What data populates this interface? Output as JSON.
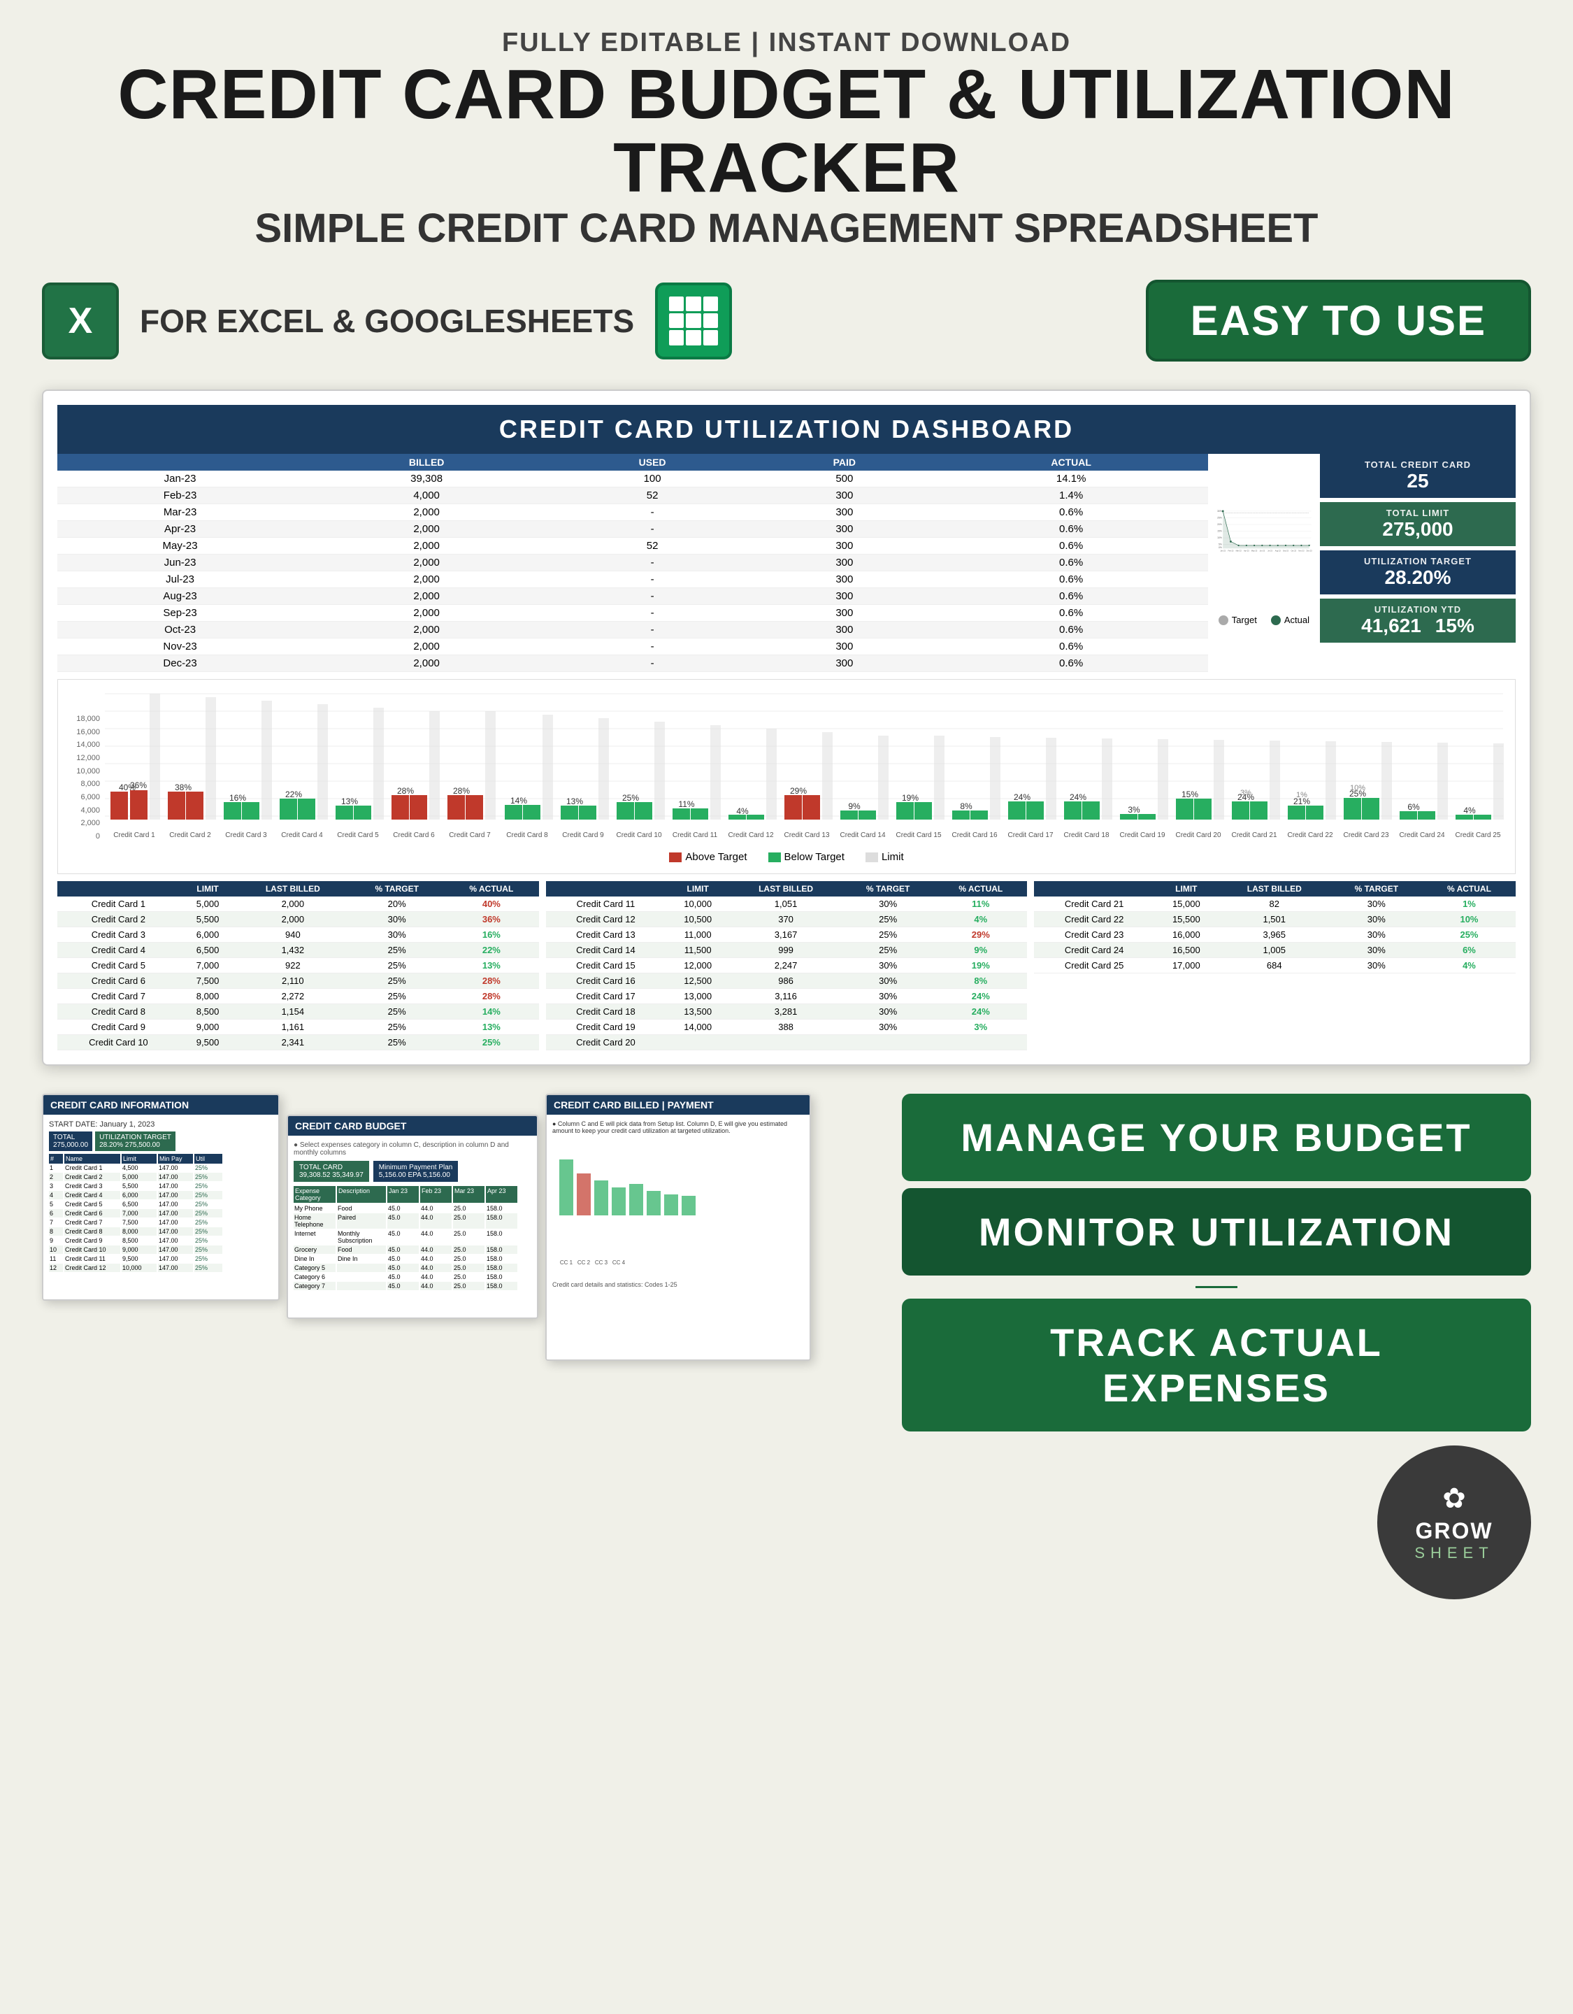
{
  "header": {
    "top_label": "FULLY EDITABLE | INSTANT DOWNLOAD",
    "main_title": "CREDIT CARD BUDGET & UTILIZATION TRACKER",
    "sub_title": "SIMPLE CREDIT CARD MANAGEMENT SPREADSHEET",
    "for_apps": "FOR EXCEL & GOOGLESHEETS",
    "easy_to_use": "EASY TO USE"
  },
  "dashboard": {
    "title": "CREDIT CARD UTILIZATION DASHBOARD",
    "table_headers": [
      "BILLED",
      "USED",
      "PAID",
      "ACTUAL"
    ],
    "rows": [
      {
        "month": "Jan-23",
        "billed": "39,308",
        "used": "100",
        "paid": "500",
        "actual": "14.1%"
      },
      {
        "month": "Feb-23",
        "billed": "4,000",
        "used": "52",
        "paid": "300",
        "actual": "1.4%"
      },
      {
        "month": "Mar-23",
        "billed": "2,000",
        "used": "-",
        "paid": "300",
        "actual": "0.6%"
      },
      {
        "month": "Apr-23",
        "billed": "2,000",
        "used": "-",
        "paid": "300",
        "actual": "0.6%"
      },
      {
        "month": "May-23",
        "billed": "2,000",
        "used": "52",
        "paid": "300",
        "actual": "0.6%"
      },
      {
        "month": "Jun-23",
        "billed": "2,000",
        "used": "-",
        "paid": "300",
        "actual": "0.6%"
      },
      {
        "month": "Jul-23",
        "billed": "2,000",
        "used": "-",
        "paid": "300",
        "actual": "0.6%"
      },
      {
        "month": "Aug-23",
        "billed": "2,000",
        "used": "-",
        "paid": "300",
        "actual": "0.6%"
      },
      {
        "month": "Sep-23",
        "billed": "2,000",
        "used": "-",
        "paid": "300",
        "actual": "0.6%"
      },
      {
        "month": "Oct-23",
        "billed": "2,000",
        "used": "-",
        "paid": "300",
        "actual": "0.6%"
      },
      {
        "month": "Nov-23",
        "billed": "2,000",
        "used": "-",
        "paid": "300",
        "actual": "0.6%"
      },
      {
        "month": "Dec-23",
        "billed": "2,000",
        "used": "-",
        "paid": "300",
        "actual": "0.6%"
      }
    ],
    "stats": {
      "total_credit_card_label": "TOTAL CREDIT CARD",
      "total_credit_card_value": "25",
      "total_limit_label": "TOTAL LIMIT",
      "total_limit_value": "275,000",
      "utilization_target_label": "UTILIZATION TARGET",
      "utilization_target_value": "28.20%",
      "utilization_ytd_label": "UTILIZATION YTD",
      "utilization_ytd_value": "41,621",
      "utilization_ytd_pct": "15%"
    }
  },
  "credit_cards": {
    "col1": [
      {
        "name": "Credit Card 1",
        "limit": "5,000",
        "billed": "2,000",
        "target": "20%",
        "actual": "40%",
        "color": "red"
      },
      {
        "name": "Credit Card 2",
        "limit": "5,500",
        "billed": "2,000",
        "target": "30%",
        "actual": "36%",
        "color": "red"
      },
      {
        "name": "Credit Card 3",
        "limit": "6,000",
        "billed": "940",
        "target": "30%",
        "actual": "16%",
        "color": "green"
      },
      {
        "name": "Credit Card 4",
        "limit": "6,500",
        "billed": "1,432",
        "target": "25%",
        "actual": "22%",
        "color": "green"
      },
      {
        "name": "Credit Card 5",
        "limit": "7,000",
        "billed": "922",
        "target": "25%",
        "actual": "13%",
        "color": "green"
      },
      {
        "name": "Credit Card 6",
        "limit": "7,500",
        "billed": "2,110",
        "target": "25%",
        "actual": "28%",
        "color": "red"
      },
      {
        "name": "Credit Card 7",
        "limit": "8,000",
        "billed": "2,272",
        "target": "25%",
        "actual": "28%",
        "color": "red"
      },
      {
        "name": "Credit Card 8",
        "limit": "8,500",
        "billed": "1,154",
        "target": "25%",
        "actual": "14%",
        "color": "green"
      },
      {
        "name": "Credit Card 9",
        "limit": "9,000",
        "billed": "1,161",
        "target": "25%",
        "actual": "13%",
        "color": "green"
      },
      {
        "name": "Credit Card 10",
        "limit": "9,500",
        "billed": "2,341",
        "target": "25%",
        "actual": "25%",
        "color": "green"
      }
    ],
    "col2": [
      {
        "name": "Credit Card 11",
        "limit": "10,000",
        "billed": "1,051",
        "target": "30%",
        "actual": "11%",
        "color": "green"
      },
      {
        "name": "Credit Card 12",
        "limit": "10,500",
        "billed": "370",
        "target": "25%",
        "actual": "4%",
        "color": "green"
      },
      {
        "name": "Credit Card 13",
        "limit": "11,000",
        "billed": "3,167",
        "target": "25%",
        "actual": "29%",
        "color": "red"
      },
      {
        "name": "Credit Card 14",
        "limit": "11,500",
        "billed": "999",
        "target": "25%",
        "actual": "9%",
        "color": "green"
      },
      {
        "name": "Credit Card 15",
        "limit": "12,000",
        "billed": "2,247",
        "target": "30%",
        "actual": "19%",
        "color": "green"
      },
      {
        "name": "Credit Card 16",
        "limit": "12,500",
        "billed": "986",
        "target": "30%",
        "actual": "8%",
        "color": "green"
      },
      {
        "name": "Credit Card 17",
        "limit": "13,000",
        "billed": "3,116",
        "target": "30%",
        "actual": "24%",
        "color": "green"
      },
      {
        "name": "Credit Card 18",
        "limit": "13,500",
        "billed": "3,281",
        "target": "30%",
        "actual": "24%",
        "color": "green"
      },
      {
        "name": "Credit Card 19",
        "limit": "14,000",
        "billed": "388",
        "target": "30%",
        "actual": "3%",
        "color": "green"
      },
      {
        "name": "Credit Card 20",
        "limit": "",
        "billed": "",
        "target": "",
        "actual": "",
        "color": ""
      }
    ],
    "col3": [
      {
        "name": "Credit Card 21",
        "limit": "15,000",
        "billed": "82",
        "target": "30%",
        "actual": "1%",
        "color": "green"
      },
      {
        "name": "Credit Card 22",
        "limit": "15,500",
        "billed": "1,501",
        "target": "30%",
        "actual": "10%",
        "color": "green"
      },
      {
        "name": "Credit Card 23",
        "limit": "16,000",
        "billed": "3,965",
        "target": "30%",
        "actual": "25%",
        "color": "green"
      },
      {
        "name": "Credit Card 24",
        "limit": "16,500",
        "billed": "1,005",
        "target": "30%",
        "actual": "6%",
        "color": "green"
      },
      {
        "name": "Credit Card 25",
        "limit": "17,000",
        "billed": "684",
        "target": "30%",
        "actual": "4%",
        "color": "green"
      }
    ]
  },
  "bar_chart": {
    "y_labels": [
      "18,000",
      "16,000",
      "14,000",
      "12,000",
      "10,000",
      "8,000",
      "6,000",
      "4,000",
      "2,000",
      "0"
    ],
    "bars": [
      {
        "label": "Credit\nCard 1",
        "above": 40,
        "below": 36,
        "limit": 100,
        "above_pct": "40%",
        "below_pct": "36%"
      },
      {
        "label": "Credit\nCard 2",
        "above": 38,
        "below": 0,
        "limit": 100,
        "above_pct": "38%",
        "below_pct": ""
      },
      {
        "label": "Credit\nCard 3",
        "above": 0,
        "below": 16,
        "limit": 100,
        "above_pct": "",
        "below_pct": "16%"
      },
      {
        "label": "Credit\nCard 4",
        "above": 0,
        "below": 22,
        "limit": 100,
        "above_pct": "",
        "below_pct": "22%"
      },
      {
        "label": "Credit\nCard 5",
        "above": 0,
        "below": 13,
        "limit": 100,
        "above_pct": "",
        "below_pct": "13%"
      },
      {
        "label": "Credit\nCard 6",
        "above": 28,
        "below": 0,
        "limit": 100,
        "above_pct": "28%",
        "below_pct": ""
      },
      {
        "label": "Credit\nCard 7",
        "above": 28,
        "below": 0,
        "limit": 100,
        "above_pct": "28%",
        "below_pct": ""
      },
      {
        "label": "Credit\nCard 8",
        "above": 0,
        "below": 14,
        "limit": 100,
        "above_pct": "",
        "below_pct": "14%"
      },
      {
        "label": "Credit\nCard 9",
        "above": 0,
        "below": 13,
        "limit": 100,
        "above_pct": "",
        "below_pct": "13%"
      },
      {
        "label": "Credit\nCard 10",
        "above": 0,
        "below": 25,
        "limit": 100,
        "above_pct": "",
        "below_pct": "25%"
      }
    ],
    "legend": {
      "above": "Above Target",
      "below": "Below Target",
      "limit": "Limit"
    }
  },
  "features": {
    "manage_budget": "MANAGE YOUR BUDGET",
    "monitor_utilization": "MONITOR UTILIZATION",
    "track_expenses": "TRACK ACTUAL EXPENSES"
  },
  "grow_sheet": {
    "name": "GROW",
    "sub": "SHEET",
    "flower": "✿"
  }
}
